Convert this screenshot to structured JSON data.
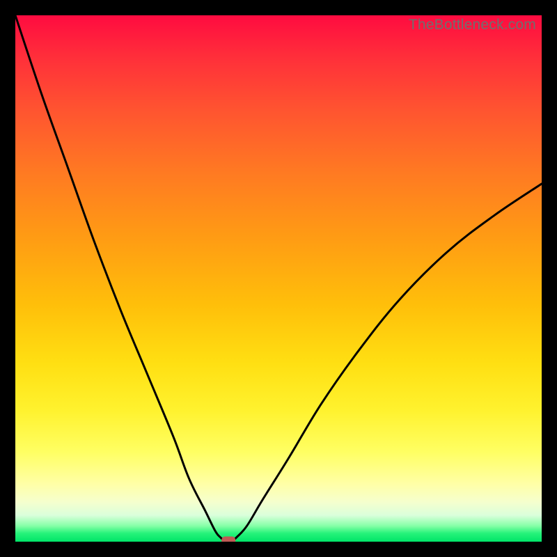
{
  "watermark": "TheBottleneck.com",
  "chart_data": {
    "type": "line",
    "title": "",
    "xlabel": "",
    "ylabel": "",
    "xlim": [
      0,
      100
    ],
    "ylim": [
      0,
      100
    ],
    "grid": false,
    "legend": false,
    "background_gradient": {
      "top": "#ff0b40",
      "bottom": "#00e468"
    },
    "series": [
      {
        "name": "curve",
        "x": [
          0,
          5,
          10,
          15,
          20,
          25,
          30,
          33,
          36,
          38,
          39,
          40,
          41,
          42,
          44,
          47,
          52,
          58,
          65,
          73,
          82,
          91,
          100
        ],
        "y": [
          100,
          85,
          71,
          57,
          44,
          32,
          20,
          12,
          6,
          2,
          0.8,
          0,
          0,
          0.8,
          3,
          8,
          16,
          26,
          36,
          46,
          55,
          62,
          68
        ]
      }
    ],
    "marker": {
      "name": "optimum",
      "x": 40.5,
      "y": 0.2,
      "color": "#c05a55"
    }
  }
}
